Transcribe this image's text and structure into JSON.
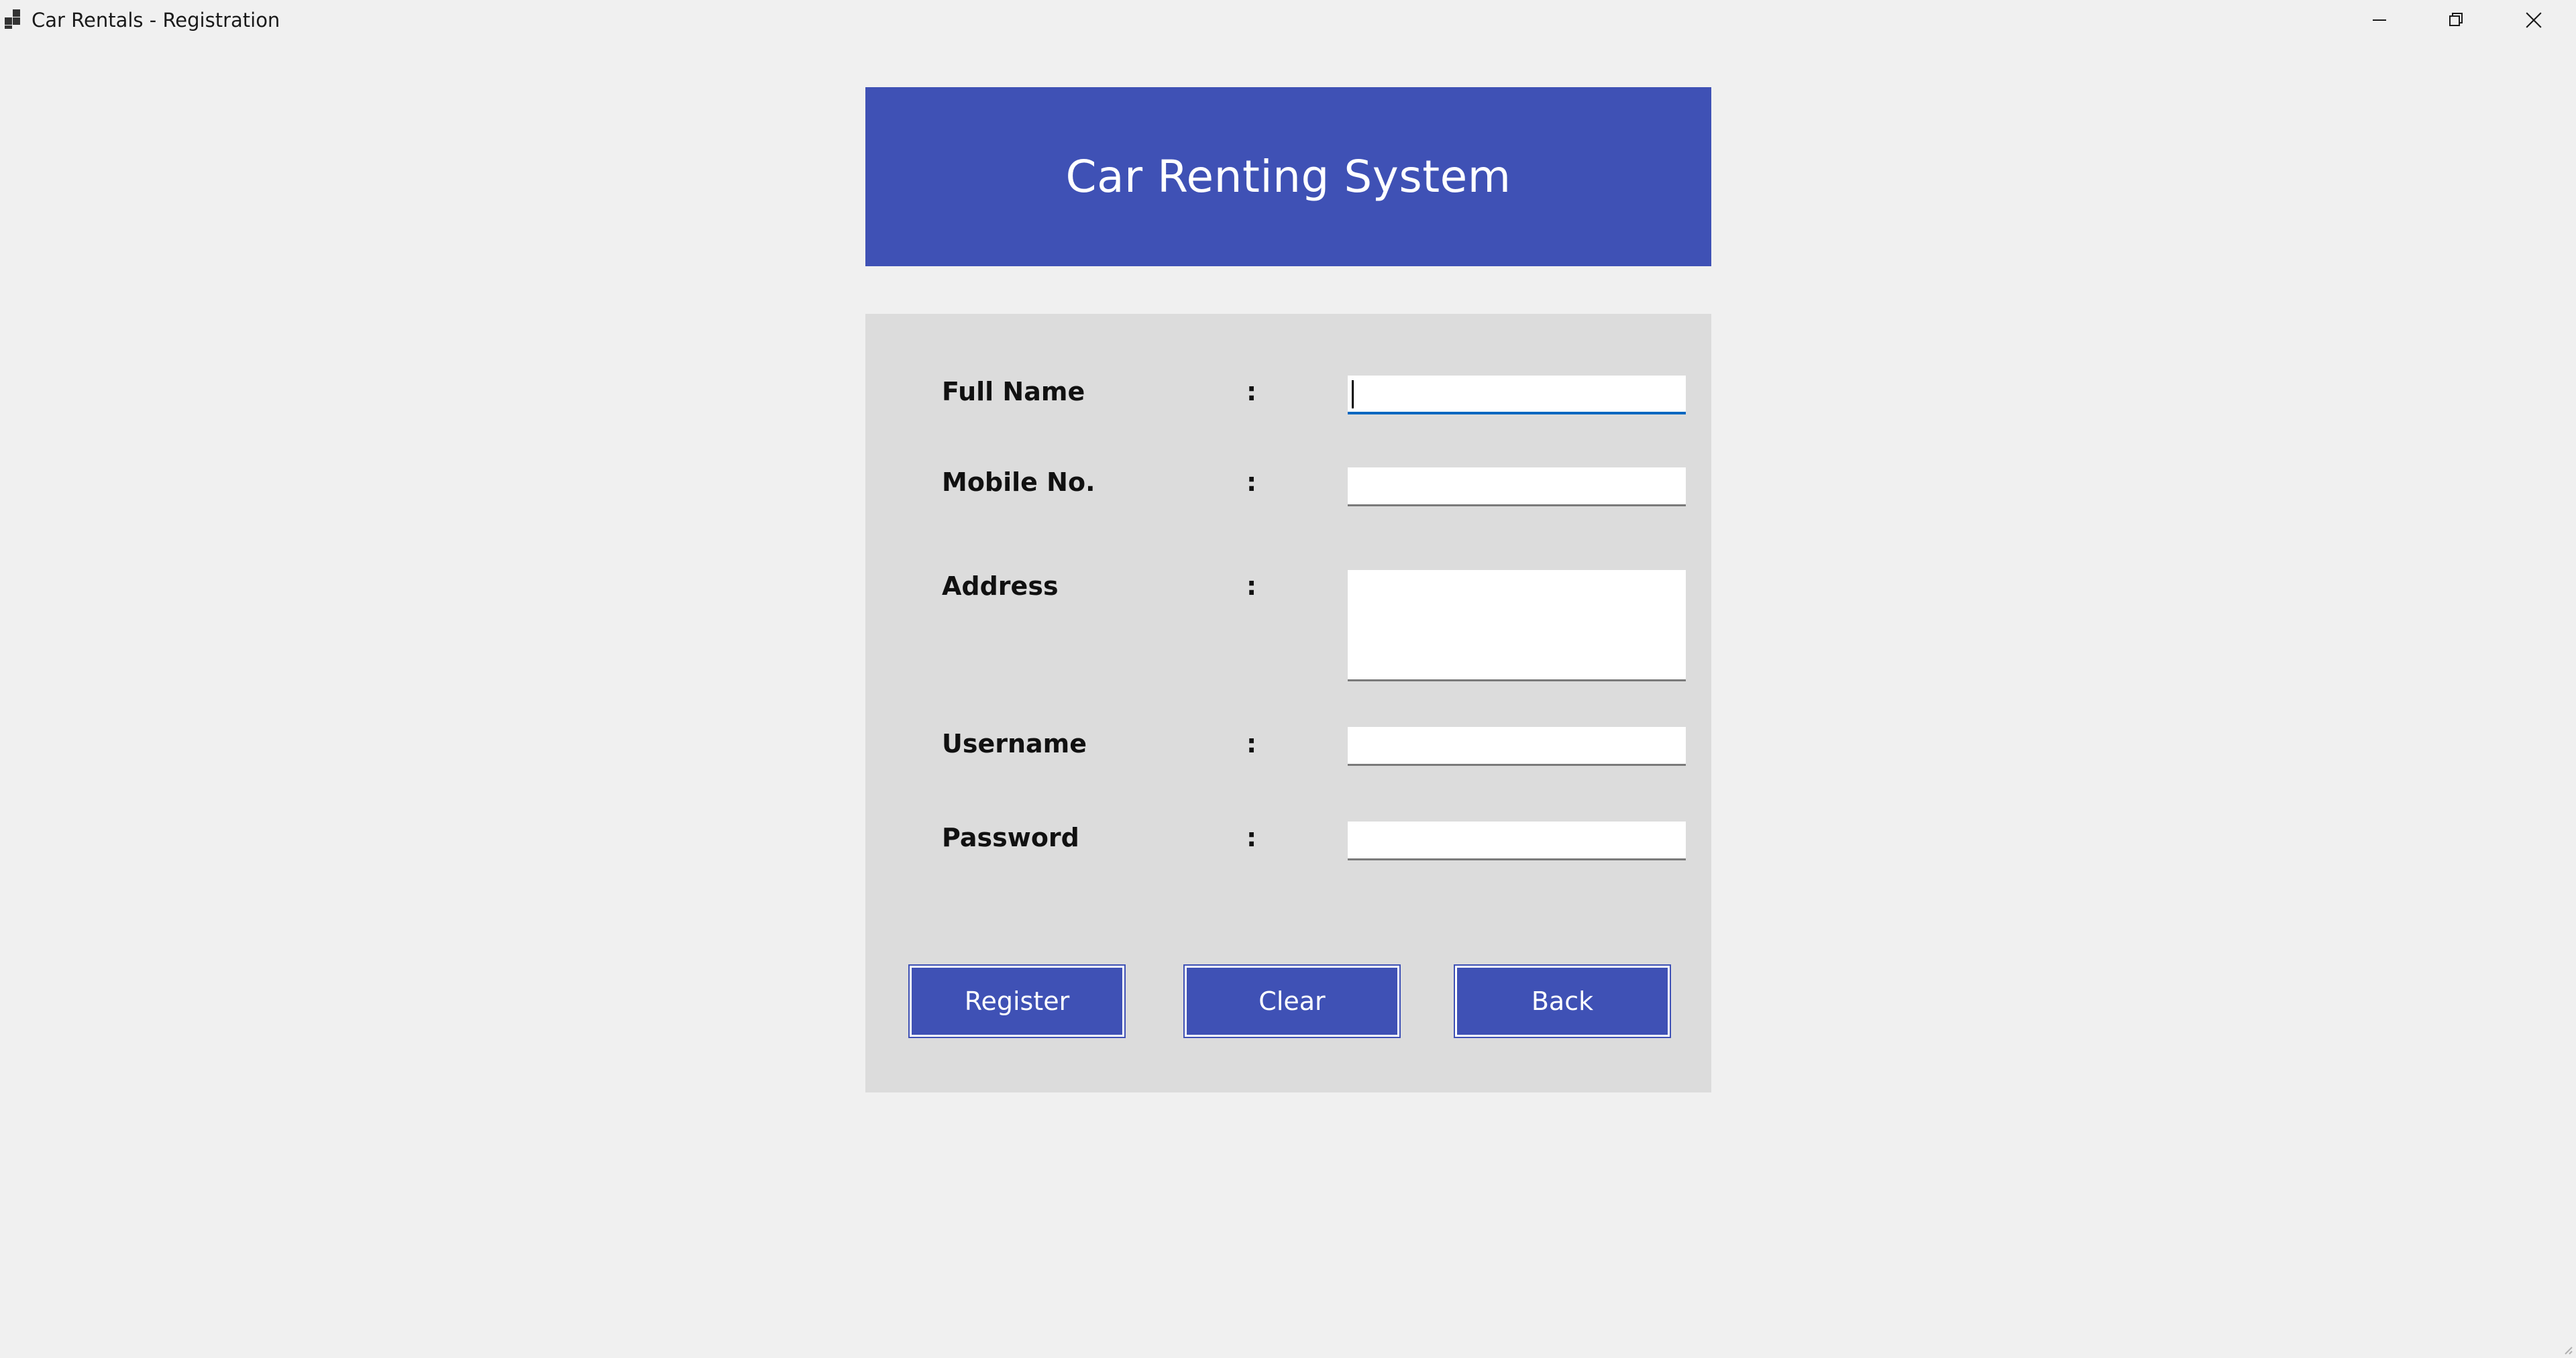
{
  "window": {
    "title": "Car Rentals - Registration",
    "controls": {
      "minimize_icon": "minimize-icon",
      "maximize_icon": "restore-icon",
      "close_icon": "close-icon"
    }
  },
  "header": {
    "title": "Car Renting System",
    "background_color": "#3f51b5"
  },
  "form": {
    "fields": [
      {
        "label": "Full Name",
        "separator": ":",
        "value": "",
        "focused": true
      },
      {
        "label": "Mobile No.",
        "separator": ":",
        "value": ""
      },
      {
        "label": "Address",
        "separator": ":",
        "value": ""
      },
      {
        "label": "Username",
        "separator": ":",
        "value": ""
      },
      {
        "label": "Password",
        "separator": ":",
        "value": ""
      }
    ]
  },
  "actions": {
    "register_label": "Register",
    "clear_label": "Clear",
    "back_label": "Back",
    "button_color": "#3f51b5"
  }
}
